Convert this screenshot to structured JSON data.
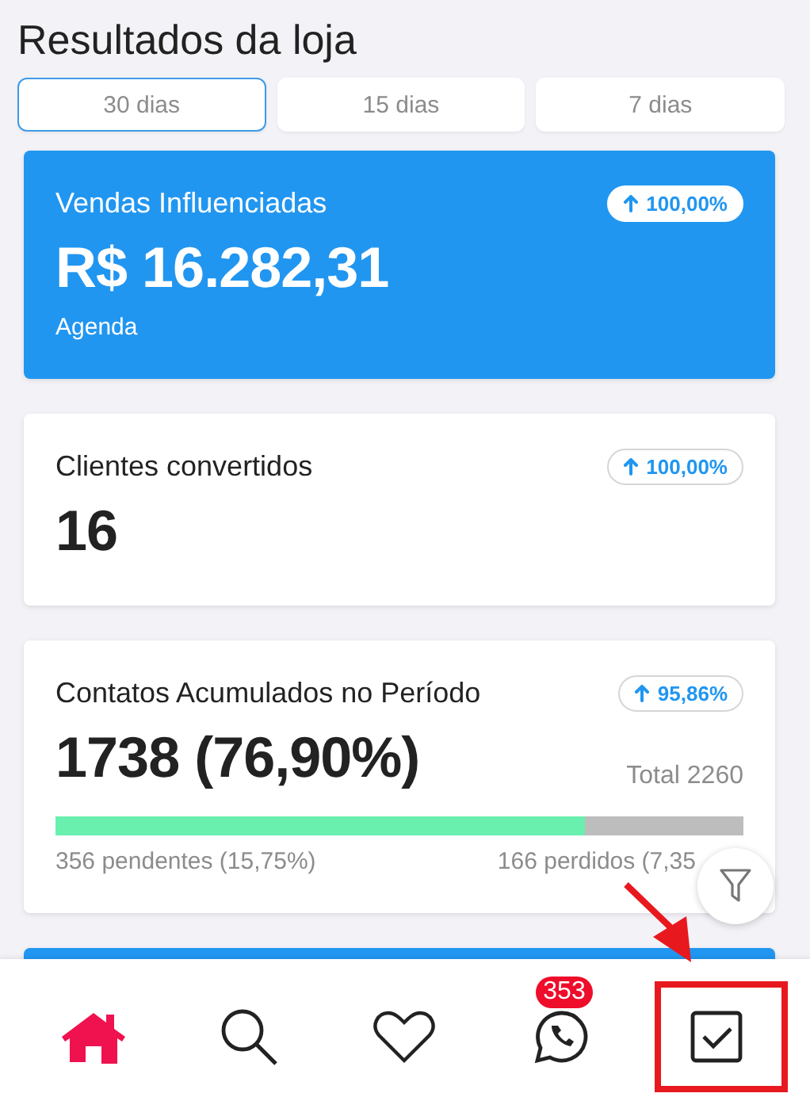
{
  "page": {
    "title": "Resultados da loja"
  },
  "tabs": [
    {
      "label": "30 dias",
      "selected": true
    },
    {
      "label": "15 dias",
      "selected": false
    },
    {
      "label": "7 dias",
      "selected": false
    }
  ],
  "cards": [
    {
      "kind": "highlight",
      "title": "Vendas Influenciadas",
      "trend": {
        "value": "100,00%"
      },
      "value": "R$ 16.282,31",
      "subtitle": "Agenda"
    },
    {
      "kind": "plain",
      "title": "Clientes convertidos",
      "trend": {
        "value": "100,00%"
      },
      "value": "16"
    },
    {
      "kind": "progress",
      "title": "Contatos Acumulados no Período",
      "trend": {
        "value": "95,86%"
      },
      "value": "1738 (76,90%)",
      "total": "Total 2260",
      "level": 0.769,
      "pending": "356 pendentes (15,75%)",
      "lost": "166 perdidos (7,35"
    },
    {
      "kind": "highlight"
    }
  ],
  "bottom_nav": [
    {
      "selected": true
    },
    {
      "selected": false
    },
    {
      "selected": false
    },
    {
      "selected": false,
      "badge": "353"
    },
    {
      "selected": false
    }
  ]
}
